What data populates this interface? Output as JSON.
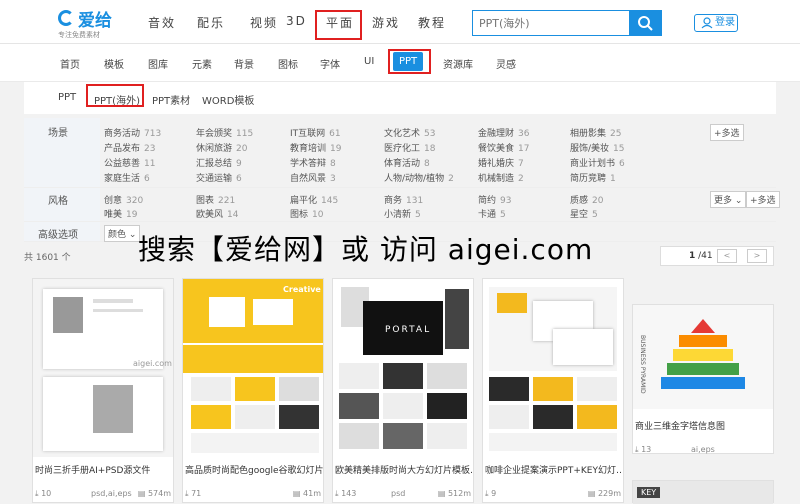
{
  "brand": {
    "logo_text": "爱给",
    "slogan": "专注免费素材"
  },
  "top_nav": [
    "音效",
    "配乐",
    "视频",
    "3D",
    "平面",
    "游戏",
    "教程"
  ],
  "search": {
    "placeholder": "PPT(海外)"
  },
  "login_label": "登录",
  "sub_nav": [
    "首页",
    "模板",
    "图库",
    "元素",
    "背景",
    "图标",
    "字体",
    "UI",
    "PPT",
    "资源库",
    "灵感"
  ],
  "tabs": [
    "PPT",
    "PPT(海外)",
    "PPT素材",
    "WORD模板"
  ],
  "filters": {
    "scene_label": "场景",
    "scene_items": [
      [
        "商务活动",
        "713"
      ],
      [
        "年会颁奖",
        "115"
      ],
      [
        "IT互联网",
        "61"
      ],
      [
        "文化艺术",
        "53"
      ],
      [
        "金融理财",
        "36"
      ],
      [
        "相册影集",
        "25"
      ],
      [
        "产品发布",
        "23"
      ],
      [
        "休闲旅游",
        "20"
      ],
      [
        "教育培训",
        "19"
      ],
      [
        "医疗化工",
        "18"
      ],
      [
        "餐饮美食",
        "17"
      ],
      [
        "服饰/美妆",
        "15"
      ],
      [
        "公益慈善",
        "11"
      ],
      [
        "汇报总结",
        "9"
      ],
      [
        "学术答辩",
        "8"
      ],
      [
        "体育活动",
        "8"
      ],
      [
        "婚礼婚庆",
        "7"
      ],
      [
        "商业计划书",
        "6"
      ],
      [
        "家庭生活",
        "6"
      ],
      [
        "交通运输",
        "6"
      ],
      [
        "自然风景",
        "3"
      ],
      [
        "人物/动物/植物",
        "2"
      ],
      [
        "机械制造",
        "2"
      ],
      [
        "简历竞聘",
        "1"
      ]
    ],
    "scene_more": "+多选",
    "style_label": "风格",
    "style_items": [
      [
        "创意",
        "320"
      ],
      [
        "图表",
        "221"
      ],
      [
        "扁平化",
        "145"
      ],
      [
        "商务",
        "131"
      ],
      [
        "简约",
        "93"
      ],
      [
        "质感",
        "20"
      ],
      [
        "唯美",
        "19"
      ],
      [
        "欧美风",
        "14"
      ],
      [
        "图标",
        "10"
      ],
      [
        "小清新",
        "5"
      ],
      [
        "卡通",
        "5"
      ],
      [
        "星空",
        "5"
      ]
    ],
    "style_more_select": "更多",
    "style_more": "+多选",
    "advanced_label": "高级选项",
    "color_select": "颜色"
  },
  "result_count": "共 1601 个",
  "pager": {
    "current": "1",
    "total": "/41",
    "prev": "<",
    "next": ">"
  },
  "overlay_text": "搜索【爱给网】或 访问 aigei.com",
  "cards": [
    {
      "title": "时尚三折手册AI+PSD源文件",
      "downloads": "10",
      "format": "psd,ai,eps",
      "size": "574m"
    },
    {
      "title": "高品质时尚配色google谷歌幻灯片…",
      "downloads": "71",
      "format": "",
      "size": "41m"
    },
    {
      "title": "欧美精美排版时尚大方幻灯片模板…",
      "downloads": "143",
      "format": "psd",
      "size": "512m"
    },
    {
      "title": "咖啡企业提案演示PPT+KEY幻灯…",
      "downloads": "9",
      "format": "",
      "size": "229m"
    },
    {
      "title": "商业三维金字塔信息图",
      "downloads": "13",
      "format": "ai,eps",
      "size": ""
    }
  ],
  "thumb_labels": {
    "aigei": "aigei.com",
    "creative": "Creative",
    "portal": "PORTAL",
    "pyramid": "BUSINESS PYRAMID",
    "key": "KEY"
  },
  "colors": {
    "accent": "#1a8fe0",
    "highlight_box": "#e02020"
  }
}
